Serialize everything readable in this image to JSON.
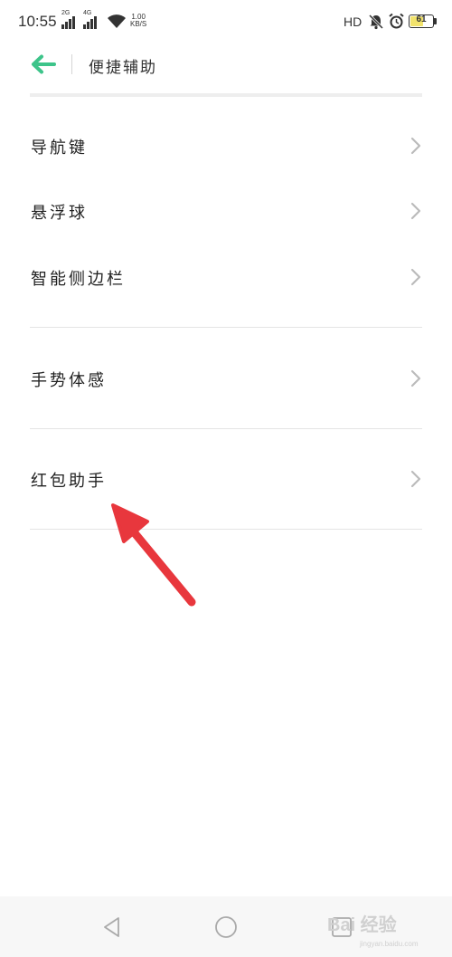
{
  "status_bar": {
    "time": "10:55",
    "signal1_label": "2G",
    "signal2_label": "4G",
    "net_speed_value": "1.00",
    "net_speed_unit": "KB/S",
    "hd_label": "HD",
    "battery_level": "61",
    "battery_fraction": 0.61,
    "icons": [
      "wifi-icon",
      "mute-bell-icon",
      "alarm-icon",
      "battery-icon"
    ]
  },
  "header": {
    "title": "便捷辅助",
    "back_icon": "arrow-left-icon",
    "accent_color": "#3dc48a"
  },
  "menu": {
    "items": [
      {
        "label": "导航键"
      },
      {
        "label": "悬浮球"
      },
      {
        "label": "智能侧边栏"
      },
      {
        "label": "手势体感"
      },
      {
        "label": "红包助手"
      }
    ],
    "chevron_icon": "chevron-right-icon",
    "chevron_color": "#bbbbbb"
  },
  "annotation": {
    "icon": "red-arrow-annotation",
    "color": "#e8373d"
  },
  "nav_bar": {
    "icons": [
      "nav-back-icon",
      "nav-home-icon",
      "nav-recents-icon"
    ]
  },
  "watermark": {
    "text": "Bai 经验",
    "sub": "jingyan.baidu.com"
  }
}
